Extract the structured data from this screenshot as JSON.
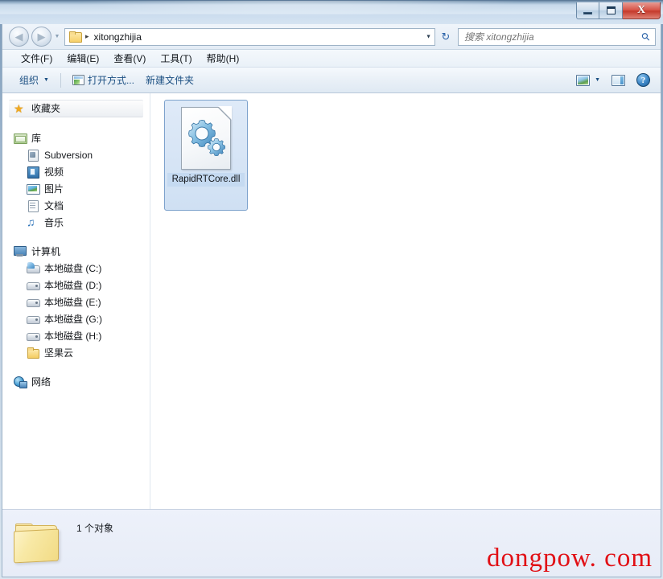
{
  "window": {
    "buttons": {
      "minimize": "–",
      "maximize": "☐",
      "close": "X"
    }
  },
  "addressbar": {
    "back_label": "◀",
    "forward_label": "▶",
    "history_caret": "▼",
    "folder_icon": "folder-icon",
    "separator": "▸",
    "path": "xitongzhijia",
    "dropdown_caret": "▼",
    "refresh_glyph": "↻"
  },
  "search": {
    "placeholder": "搜索 xitongzhijia",
    "value": "",
    "icon": "search-icon"
  },
  "menubar": {
    "items": [
      {
        "label": "文件(F)"
      },
      {
        "label": "编辑(E)"
      },
      {
        "label": "查看(V)"
      },
      {
        "label": "工具(T)"
      },
      {
        "label": "帮助(H)"
      }
    ]
  },
  "toolbar": {
    "organize_label": "组织",
    "organize_caret": "▼",
    "open_with_label": "打开方式...",
    "new_folder_label": "新建文件夹",
    "view_caret": "▼",
    "help_glyph": "?"
  },
  "sidebar": {
    "groups": [
      {
        "name": "favorites",
        "highlight": true,
        "items": [
          {
            "label": "收藏夹",
            "icon": "star-icon",
            "level": "root"
          }
        ]
      },
      {
        "name": "libraries",
        "items": [
          {
            "label": "库",
            "icon": "library-icon",
            "level": "root"
          },
          {
            "label": "Subversion",
            "icon": "subversion-icon",
            "level": "child"
          },
          {
            "label": "视频",
            "icon": "video-icon",
            "level": "child"
          },
          {
            "label": "图片",
            "icon": "picture-icon",
            "level": "child"
          },
          {
            "label": "文档",
            "icon": "document-icon",
            "level": "child"
          },
          {
            "label": "音乐",
            "icon": "music-icon",
            "level": "child"
          }
        ]
      },
      {
        "name": "computer",
        "items": [
          {
            "label": "计算机",
            "icon": "computer-icon",
            "level": "root"
          },
          {
            "label": "本地磁盘 (C:)",
            "icon": "system-drive-icon",
            "level": "child"
          },
          {
            "label": "本地磁盘 (D:)",
            "icon": "drive-icon",
            "level": "child"
          },
          {
            "label": "本地磁盘 (E:)",
            "icon": "drive-icon",
            "level": "child"
          },
          {
            "label": "本地磁盘 (G:)",
            "icon": "drive-icon",
            "level": "child"
          },
          {
            "label": "本地磁盘 (H:)",
            "icon": "drive-icon",
            "level": "child"
          },
          {
            "label": "坚果云",
            "icon": "folder-icon",
            "level": "child"
          }
        ]
      },
      {
        "name": "network",
        "items": [
          {
            "label": "网络",
            "icon": "network-icon",
            "level": "root"
          }
        ]
      }
    ]
  },
  "content": {
    "files": [
      {
        "name": "RapidRTCore.dll",
        "icon": "dll-gears-icon",
        "selected": true
      }
    ]
  },
  "statusbar": {
    "folder_icon": "large-folder-icon",
    "text": "1 个对象"
  },
  "watermark": {
    "text": "dongpow. com",
    "color": "#e10f15"
  },
  "colors": {
    "selection": "#cfe0f3",
    "selection_border": "#7da2cc",
    "accent_link": "#1b4f82",
    "close_button": "#c53a2c",
    "titlebar": "#d6e4f2"
  }
}
